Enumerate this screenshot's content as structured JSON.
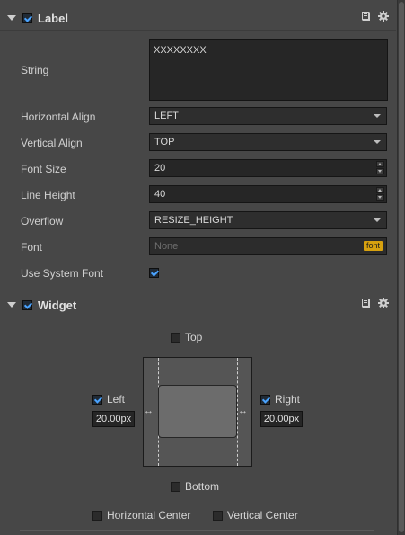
{
  "label_section": {
    "title": "Label",
    "fields": {
      "string": {
        "label": "String",
        "value": "XXXXXXXX"
      },
      "horizontal_align": {
        "label": "Horizontal Align",
        "value": "LEFT"
      },
      "vertical_align": {
        "label": "Vertical Align",
        "value": "TOP"
      },
      "font_size": {
        "label": "Font Size",
        "value": "20"
      },
      "line_height": {
        "label": "Line Height",
        "value": "40"
      },
      "overflow": {
        "label": "Overflow",
        "value": "RESIZE_HEIGHT"
      },
      "font": {
        "label": "Font",
        "placeholder": "None",
        "badge": "font"
      },
      "use_system_font": {
        "label": "Use System Font",
        "checked": true
      }
    }
  },
  "widget_section": {
    "title": "Widget",
    "top_label": "Top",
    "bottom_label": "Bottom",
    "left_label": "Left",
    "right_label": "Right",
    "left_value": "20.00px",
    "right_value": "20.00px",
    "horizontal_center_label": "Horizontal Center",
    "vertical_center_label": "Vertical Center",
    "arrow_glyph": "↔"
  },
  "icons": {
    "help": "book-icon",
    "settings": "gear-icon"
  },
  "colors": {
    "background": "#474747",
    "accent": "#4aa3ff",
    "font_badge": "#d7a10f"
  }
}
